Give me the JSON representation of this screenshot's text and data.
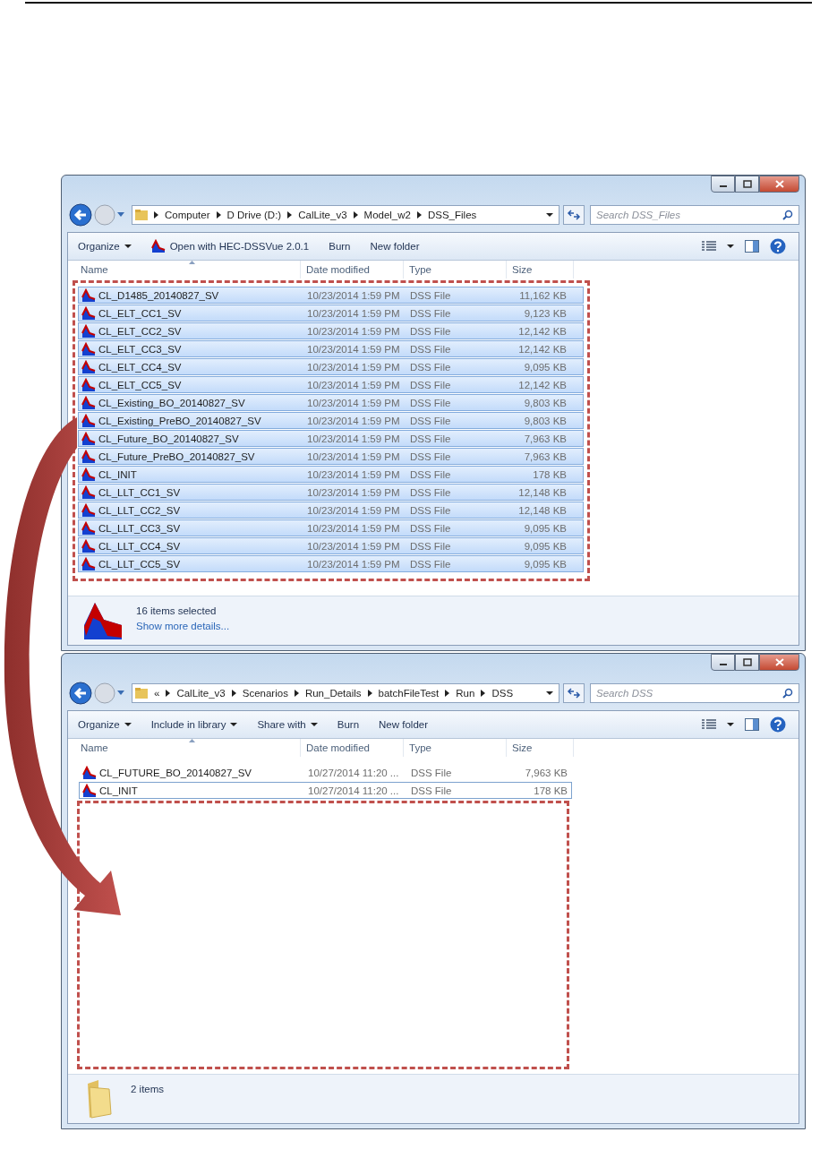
{
  "windows": [
    {
      "address": {
        "crumbs": [
          "Computer",
          "D Drive (D:)",
          "CalLite_v3",
          "Model_w2",
          "DSS_Files"
        ]
      },
      "search": {
        "placeholder": "Search DSS_Files"
      },
      "toolbar": [
        {
          "label": "Organize",
          "kind": "dropdown"
        },
        {
          "label": "Open with HEC-DSSVue 2.0.1",
          "kind": "app"
        },
        {
          "label": "Burn",
          "kind": "plain"
        },
        {
          "label": "New folder",
          "kind": "plain"
        }
      ],
      "columns": [
        "Name",
        "Date modified",
        "Type",
        "Size"
      ],
      "frame_around_rows": true,
      "rows": [
        {
          "name": "CL_D1485_20140827_SV",
          "date": "10/23/2014 1:59 PM",
          "type": "DSS File",
          "size": "11,162 KB",
          "selected": true,
          "focused": false
        },
        {
          "name": "CL_ELT_CC1_SV",
          "date": "10/23/2014 1:59 PM",
          "type": "DSS File",
          "size": "9,123 KB",
          "selected": true,
          "focused": false
        },
        {
          "name": "CL_ELT_CC2_SV",
          "date": "10/23/2014 1:59 PM",
          "type": "DSS File",
          "size": "12,142 KB",
          "selected": true,
          "focused": false
        },
        {
          "name": "CL_ELT_CC3_SV",
          "date": "10/23/2014 1:59 PM",
          "type": "DSS File",
          "size": "12,142 KB",
          "selected": true,
          "focused": false
        },
        {
          "name": "CL_ELT_CC4_SV",
          "date": "10/23/2014 1:59 PM",
          "type": "DSS File",
          "size": "9,095 KB",
          "selected": true,
          "focused": false
        },
        {
          "name": "CL_ELT_CC5_SV",
          "date": "10/23/2014 1:59 PM",
          "type": "DSS File",
          "size": "12,142 KB",
          "selected": true,
          "focused": false
        },
        {
          "name": "CL_Existing_BO_20140827_SV",
          "date": "10/23/2014 1:59 PM",
          "type": "DSS File",
          "size": "9,803 KB",
          "selected": true,
          "focused": false
        },
        {
          "name": "CL_Existing_PreBO_20140827_SV",
          "date": "10/23/2014 1:59 PM",
          "type": "DSS File",
          "size": "9,803 KB",
          "selected": true,
          "focused": false
        },
        {
          "name": "CL_Future_BO_20140827_SV",
          "date": "10/23/2014 1:59 PM",
          "type": "DSS File",
          "size": "7,963 KB",
          "selected": true,
          "focused": false
        },
        {
          "name": "CL_Future_PreBO_20140827_SV",
          "date": "10/23/2014 1:59 PM",
          "type": "DSS File",
          "size": "7,963 KB",
          "selected": true,
          "focused": false
        },
        {
          "name": "CL_INIT",
          "date": "10/23/2014 1:59 PM",
          "type": "DSS File",
          "size": "178 KB",
          "selected": true,
          "focused": false
        },
        {
          "name": "CL_LLT_CC1_SV",
          "date": "10/23/2014 1:59 PM",
          "type": "DSS File",
          "size": "12,148 KB",
          "selected": true,
          "focused": false
        },
        {
          "name": "CL_LLT_CC2_SV",
          "date": "10/23/2014 1:59 PM",
          "type": "DSS File",
          "size": "12,148 KB",
          "selected": true,
          "focused": false
        },
        {
          "name": "CL_LLT_CC3_SV",
          "date": "10/23/2014 1:59 PM",
          "type": "DSS File",
          "size": "9,095 KB",
          "selected": true,
          "focused": false
        },
        {
          "name": "CL_LLT_CC4_SV",
          "date": "10/23/2014 1:59 PM",
          "type": "DSS File",
          "size": "9,095 KB",
          "selected": true,
          "focused": false
        },
        {
          "name": "CL_LLT_CC5_SV",
          "date": "10/23/2014 1:59 PM",
          "type": "DSS File",
          "size": "9,095 KB",
          "selected": true,
          "focused": false
        }
      ],
      "status": {
        "kind": "file",
        "text": "16 items selected",
        "link": "Show more details..."
      }
    },
    {
      "address": {
        "overflow": "«",
        "crumbs": [
          "CalLite_v3",
          "Scenarios",
          "Run_Details",
          "batchFileTest",
          "Run",
          "DSS"
        ]
      },
      "search": {
        "placeholder": "Search DSS"
      },
      "toolbar": [
        {
          "label": "Organize",
          "kind": "dropdown"
        },
        {
          "label": "Include in library",
          "kind": "dropdown"
        },
        {
          "label": "Share with",
          "kind": "dropdown"
        },
        {
          "label": "Burn",
          "kind": "plain"
        },
        {
          "label": "New folder",
          "kind": "plain"
        }
      ],
      "columns": [
        "Name",
        "Date modified",
        "Type",
        "Size"
      ],
      "frame_around_rows": false,
      "rows": [
        {
          "name": "CL_FUTURE_BO_20140827_SV",
          "date": "10/27/2014 11:20 ...",
          "type": "DSS File",
          "size": "7,963 KB",
          "selected": false,
          "focused": false
        },
        {
          "name": "CL_INIT",
          "date": "10/27/2014 11:20 ...",
          "type": "DSS File",
          "size": "178 KB",
          "selected": false,
          "focused": true
        }
      ],
      "status": {
        "kind": "folder",
        "text": "2 items"
      }
    }
  ]
}
